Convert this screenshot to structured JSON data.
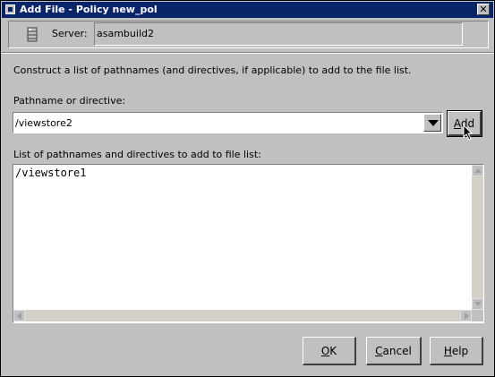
{
  "window": {
    "title": "Add File - Policy new_pol",
    "close_glyph": "✕"
  },
  "server": {
    "label": "Server:",
    "value": "asambuild2",
    "icon": "server-icon"
  },
  "instructions": "Construct a list of pathnames (and directives, if applicable) to add to the file list.",
  "pathname": {
    "label": "Pathname or directive:",
    "value": "/viewstore2"
  },
  "add_button": {
    "prefix": "",
    "mnemonic": "A",
    "rest": "dd"
  },
  "list": {
    "label": "List of pathnames and directives to add to file list:",
    "content": "/viewstore1"
  },
  "buttons": {
    "ok": {
      "mnemonic": "O",
      "rest": "K"
    },
    "cancel": {
      "mnemonic": "C",
      "rest": "ancel"
    },
    "help": {
      "mnemonic": "H",
      "rest": "elp"
    }
  },
  "colors": {
    "titlebar": "#0a246a",
    "face": "#c0c0c0"
  }
}
